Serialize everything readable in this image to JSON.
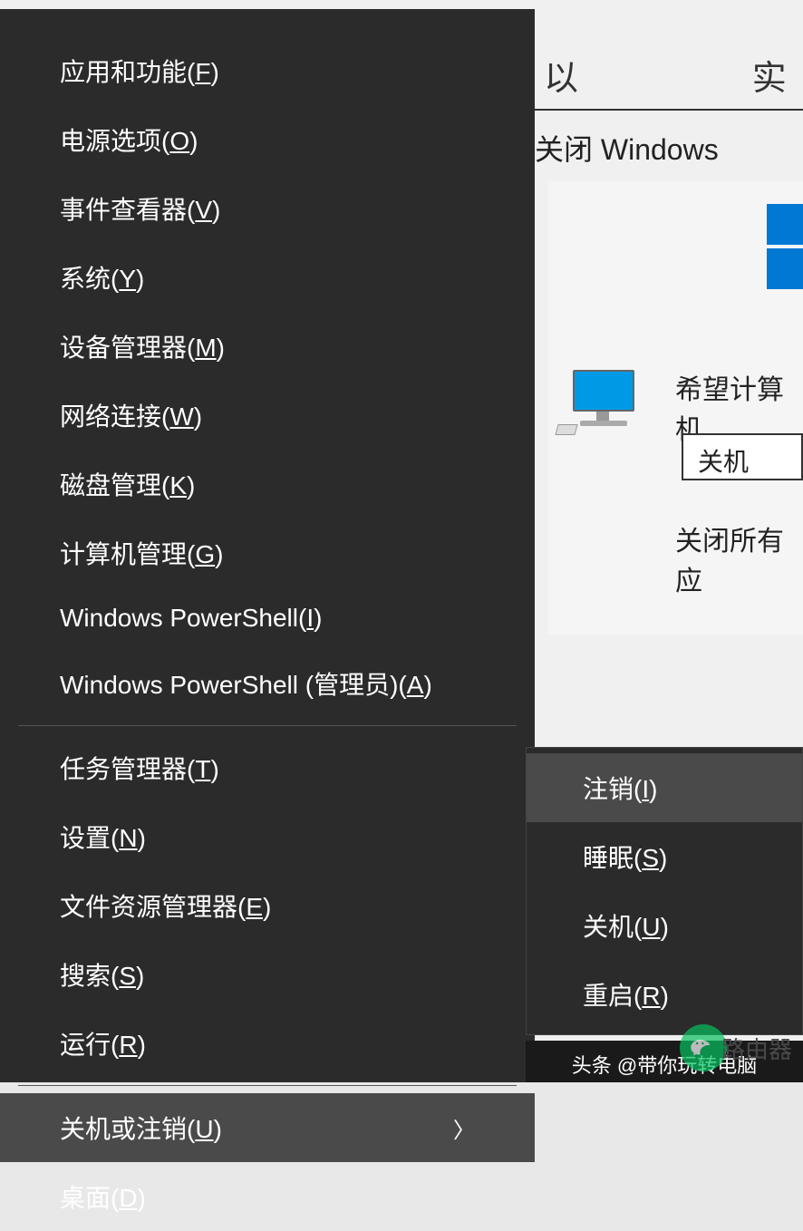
{
  "background": {
    "header_text": "以",
    "header_text2": "实",
    "shutdown_title": "关闭 Windows",
    "desire_label": "希望计算机",
    "shutdown_option": "关机",
    "close_apps": "关闭所有应"
  },
  "menu": {
    "items": [
      {
        "label": "应用和功能(",
        "key": "F",
        "suffix": ")"
      },
      {
        "label": "电源选项(",
        "key": "O",
        "suffix": ")"
      },
      {
        "label": "事件查看器(",
        "key": "V",
        "suffix": ")"
      },
      {
        "label": "系统(",
        "key": "Y",
        "suffix": ")"
      },
      {
        "label": "设备管理器(",
        "key": "M",
        "suffix": ")"
      },
      {
        "label": "网络连接(",
        "key": "W",
        "suffix": ")"
      },
      {
        "label": "磁盘管理(",
        "key": "K",
        "suffix": ")"
      },
      {
        "label": "计算机管理(",
        "key": "G",
        "suffix": ")"
      },
      {
        "label": "Windows PowerShell(",
        "key": "I",
        "suffix": ")"
      },
      {
        "label": "Windows PowerShell (管理员)(",
        "key": "A",
        "suffix": ")"
      }
    ],
    "items2": [
      {
        "label": "任务管理器(",
        "key": "T",
        "suffix": ")"
      },
      {
        "label": "设置(",
        "key": "N",
        "suffix": ")"
      },
      {
        "label": "文件资源管理器(",
        "key": "E",
        "suffix": ")"
      },
      {
        "label": "搜索(",
        "key": "S",
        "suffix": ")"
      },
      {
        "label": "运行(",
        "key": "R",
        "suffix": ")"
      }
    ],
    "items3": [
      {
        "label": "关机或注销(",
        "key": "U",
        "suffix": ")",
        "highlighted": true,
        "has_submenu": true
      },
      {
        "label": "桌面(",
        "key": "D",
        "suffix": ")"
      }
    ]
  },
  "submenu": {
    "items": [
      {
        "label": "注销(",
        "key": "I",
        "suffix": ")",
        "highlighted": true
      },
      {
        "label": "睡眠(",
        "key": "S",
        "suffix": ")"
      },
      {
        "label": "关机(",
        "key": "U",
        "suffix": ")"
      },
      {
        "label": "重启(",
        "key": "R",
        "suffix": ")"
      }
    ]
  },
  "watermark": {
    "text": "头条 @带你玩转电脑",
    "router": "路由器"
  }
}
